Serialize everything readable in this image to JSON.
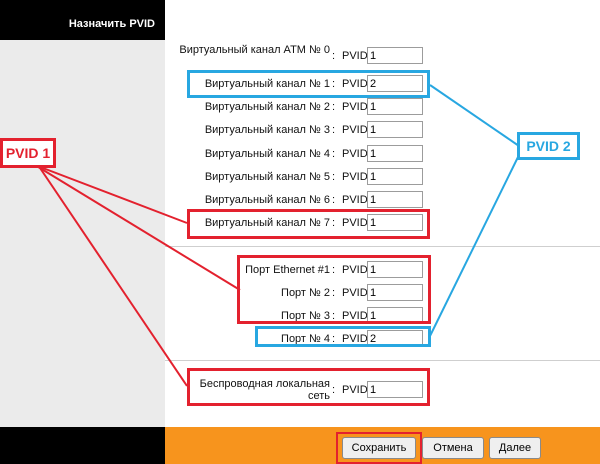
{
  "sidebar": {
    "title": "Назначить PVID"
  },
  "common": {
    "colon": ":",
    "pvid_label": "PVID"
  },
  "atm_channels": [
    {
      "label": "Виртуальный канал ATM № 0",
      "value": "1"
    },
    {
      "label": "Виртуальный канал № 1",
      "value": "2"
    },
    {
      "label": "Виртуальный канал № 2",
      "value": "1"
    },
    {
      "label": "Виртуальный канал № 3",
      "value": "1"
    },
    {
      "label": "Виртуальный канал № 4",
      "value": "1"
    },
    {
      "label": "Виртуальный канал № 5",
      "value": "1"
    },
    {
      "label": "Виртуальный канал № 6",
      "value": "1"
    },
    {
      "label": "Виртуальный канал № 7",
      "value": "1"
    }
  ],
  "ports": [
    {
      "label": "Порт Ethernet #1",
      "value": "1"
    },
    {
      "label": "Порт № 2",
      "value": "1"
    },
    {
      "label": "Порт № 3",
      "value": "1"
    },
    {
      "label": "Порт № 4",
      "value": "2"
    }
  ],
  "wireless": {
    "label": "Беспроводная локальная сеть",
    "value": "1"
  },
  "buttons": {
    "save": "Сохранить",
    "cancel": "Отмена",
    "next": "Далее"
  },
  "annotations": {
    "pvid1": "PVID 1",
    "pvid2": "PVID 2",
    "red": "#e3212e",
    "blue": "#28a7e1"
  },
  "colors": {
    "footer": "#f7941d",
    "header": "#000000"
  }
}
